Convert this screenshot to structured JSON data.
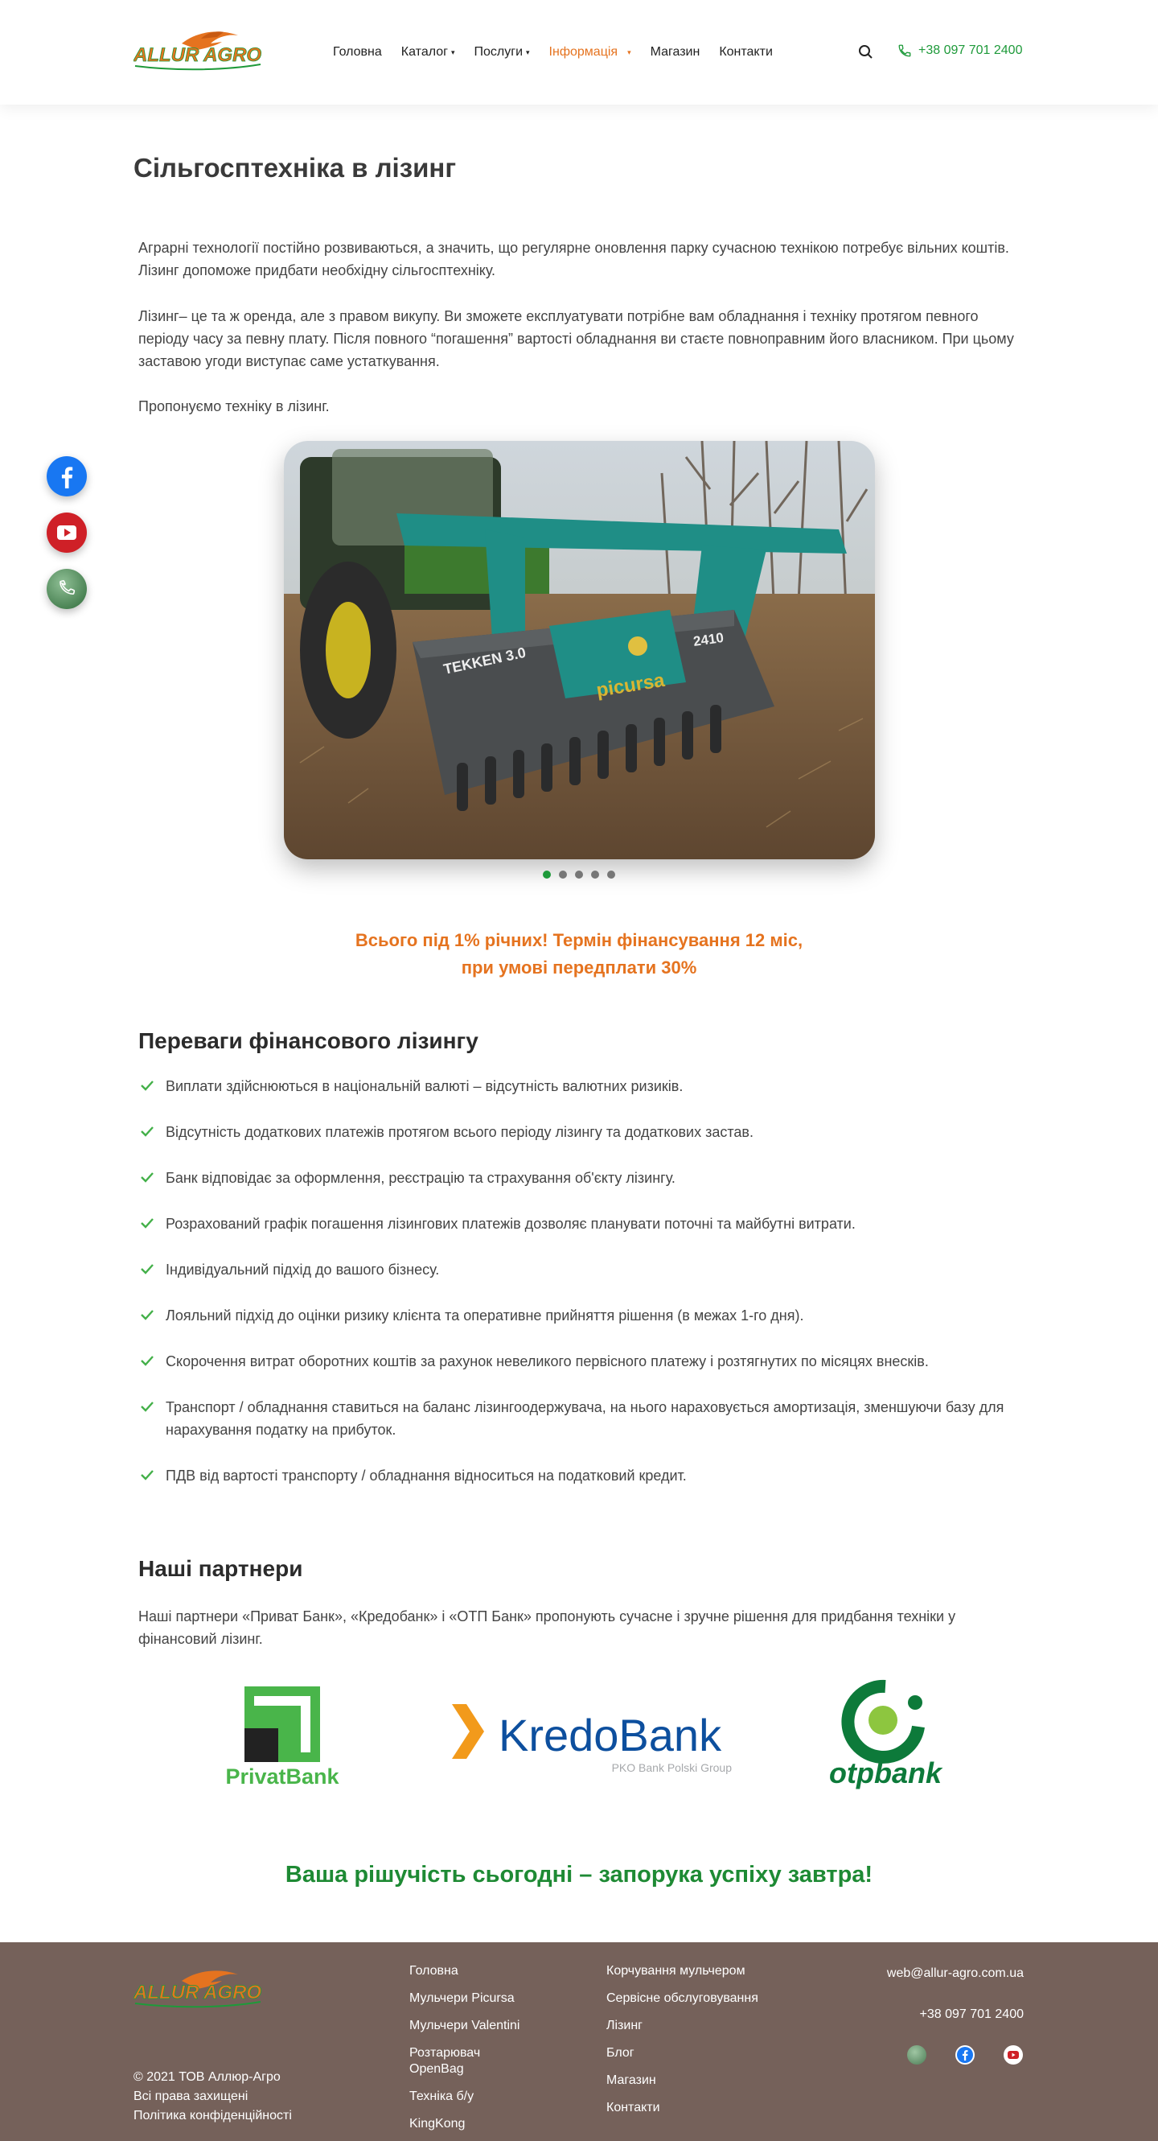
{
  "header": {
    "logo_text": "ALLUR AGRO",
    "nav": [
      {
        "label": "Головна",
        "has_dropdown": false,
        "active": false
      },
      {
        "label": "Каталог",
        "has_dropdown": true,
        "active": false
      },
      {
        "label": "Послуги",
        "has_dropdown": true,
        "active": false
      },
      {
        "label": "Інформація",
        "has_dropdown": true,
        "active": true
      },
      {
        "label": "Магазин",
        "has_dropdown": false,
        "active": false
      },
      {
        "label": "Контакти",
        "has_dropdown": false,
        "active": false
      }
    ],
    "search_icon": "search-icon",
    "phone_icon": "phone-icon",
    "phone": "+38 097 701 2400"
  },
  "page": {
    "title": "Сільгосптехніка в лізинг",
    "paragraphs": [
      "Аграрні технології постійно розвиваються, а значить, що регулярне оновлення парку сучасною технікою потребує вільних коштів. Лізинг допоможе придбати необхідну сільгосптехніку.",
      "Лізинг– це та ж оренда, але з правом викупу. Ви зможете експлуатувати потрібне вам обладнання і техніку протягом певного періоду часу за певну плату. Після повного “погашення” вартості обладнання ви стаєте повноправним його власником. При цьому заставою угоди виступає саме устаткування.",
      "Пропонуємо техніку в лізинг."
    ],
    "slider": {
      "slide_count": 5,
      "active_index": 0,
      "image_labels": [
        "TEKKEN 3.0",
        "2410",
        "picursa"
      ]
    },
    "promo_line1": "Всього під 1% річних! Термін фінансування 12 міс,",
    "promo_line2": "при умові передплати 30%",
    "advantages_title": "Переваги фінансового лізингу",
    "advantages": [
      "Виплати здійснюються в національній валюті  – відсутність валютних ризиків.",
      "Відсутність додаткових платежів протягом всього періоду лізингу та додаткових застав.",
      "Банк відповідає за оформлення, реєстрацію та страхування об'єкту лізингу.",
      "Розрахований графік погашення лізингових платежів дозволяє планувати поточні та майбутні витрати.",
      "Індивідуальний підхід до вашого бізнесу.",
      "Лояльний підхід до оцінки ризику клієнта та оперативне прийняття рішення (в межах 1-го дня).",
      "Скорочення витрат оборотних коштів за рахунок невеликого первісного платежу і розтягнутих по місяцях внесків.",
      "Транспорт / обладнання ставиться на баланс лізингоодержувача, на нього нараховується амортизація, зменшуючи базу для нарахування податку на прибуток.",
      "ПДВ від вартості транспорту / обладнання відноситься на податковий кредит."
    ],
    "partners_title": "Наші партнери",
    "partners_text": "Наші партнери «Приват Банк», «Кредобанк» і «ОТП Банк» пропонують сучасне і зручне рішення для придбання техніки у фінансовий лізинг.",
    "partners": [
      {
        "name": "PrivatBank",
        "tagline": ""
      },
      {
        "name": "KredoBank",
        "tagline": "PKO Bank Polski Group"
      },
      {
        "name": "otpbank",
        "tagline": ""
      }
    ],
    "slogan": "Ваша рішучість сьогодні – запорука успіху завтра!"
  },
  "social_float": [
    "facebook-icon",
    "youtube-icon",
    "phone-icon"
  ],
  "footer": {
    "logo_text": "ALLUR AGRO",
    "copyright": "© 2021 ТОВ Аллюр-Агро",
    "rights": "Всі права захищені",
    "privacy": "Політика конфіденційності",
    "col1": [
      "Головна",
      "Мульчери Picursa",
      "Мульчери Valentini",
      "Розтарювач OpenBag",
      "Техніка б/у",
      "KingKong"
    ],
    "col1_display": [
      "Головна",
      "Мульчери Picursa",
      "Мульчери Valentini",
      "Розтарювач",
      "OpenBag",
      "Техніка б/у",
      "KingKong"
    ],
    "col2": [
      "Корчування мульчером",
      "Сервісне обслуговування",
      "Лізинг",
      "Блог",
      "Магазин",
      "Контакти"
    ],
    "email": "web@allur-agro.com.ua",
    "phone": "+38 097 701 2400"
  },
  "colors": {
    "accent_orange": "#e5731f",
    "brand_green": "#1e9a3a",
    "footer_bg": "#75615a"
  }
}
